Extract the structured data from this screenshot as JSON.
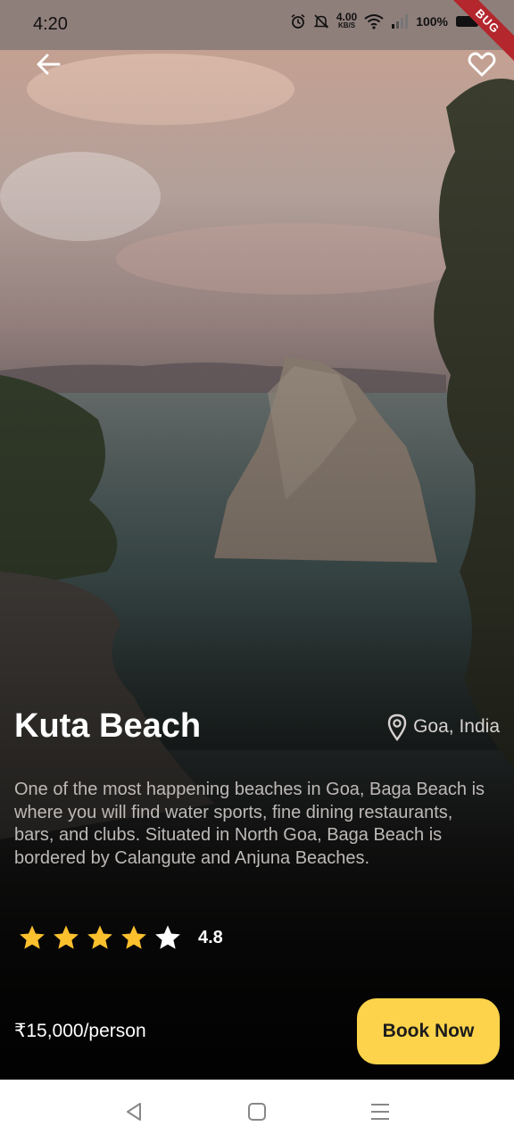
{
  "status_bar": {
    "time": "4:20",
    "net_speed_value": "4.00",
    "net_speed_unit": "KB/S",
    "battery": "100%",
    "debug_banner": "BUG"
  },
  "header": {
    "back_icon": "arrow-left-icon",
    "favorite_icon": "heart-outline-icon"
  },
  "place": {
    "name": "Kuta Beach",
    "location": "Goa, India",
    "description": "One of the most happening beaches in Goa, Baga Beach is where you will find water sports, fine dining restaurants, bars, and clubs. Situated in North Goa, Baga Beach is bordered by Calangute and Anjuna Beaches.",
    "rating": "4.8",
    "stars_filled": 4,
    "stars_total": 5
  },
  "booking": {
    "price": "₹15,000/person",
    "book_label": "Book Now"
  },
  "colors": {
    "accent": "#fdd34b",
    "star_filled": "#fbc02d",
    "star_empty": "#ffffff"
  }
}
